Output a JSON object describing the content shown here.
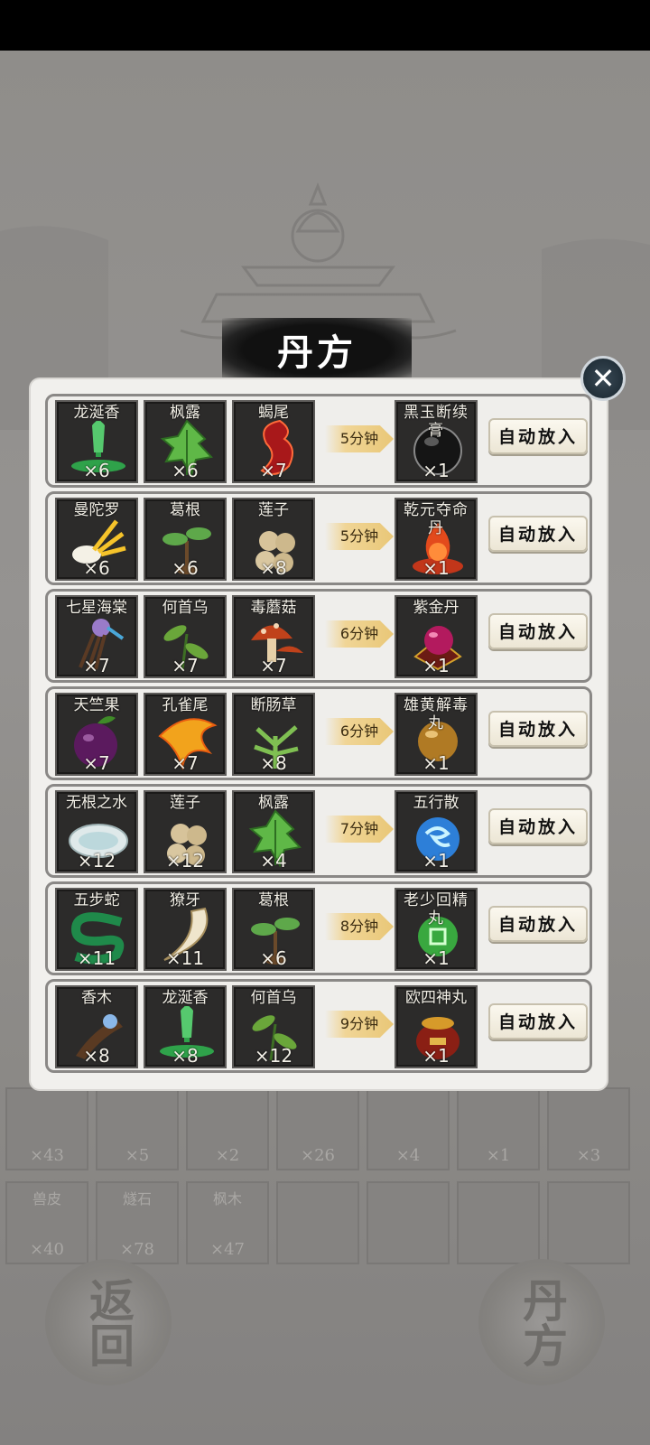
{
  "title": "丹方",
  "recipes": [
    {
      "ingredients": [
        {
          "name": "龙涎香",
          "count": "×6",
          "icon": "green-ooze-icon"
        },
        {
          "name": "枫露",
          "count": "×6",
          "icon": "green-leaf-icon"
        },
        {
          "name": "蝎尾",
          "count": "×7",
          "icon": "red-scorpion-tail-icon"
        }
      ],
      "time": "5分钟",
      "product": {
        "name": "黑玉断续膏",
        "count": "×1",
        "icon": "black-orb-icon"
      },
      "action": "自动放入"
    },
    {
      "ingredients": [
        {
          "name": "曼陀罗",
          "count": "×6",
          "icon": "white-flower-icon"
        },
        {
          "name": "葛根",
          "count": "×6",
          "icon": "sprout-icon"
        },
        {
          "name": "莲子",
          "count": "×8",
          "icon": "lotus-seed-icon"
        }
      ],
      "time": "5分钟",
      "product": {
        "name": "乾元夺命丹",
        "count": "×1",
        "icon": "red-flame-pill-icon"
      },
      "action": "自动放入"
    },
    {
      "ingredients": [
        {
          "name": "七星海棠",
          "count": "×7",
          "icon": "purple-flower-icon"
        },
        {
          "name": "何首乌",
          "count": "×7",
          "icon": "green-herb-icon"
        },
        {
          "name": "毒蘑菇",
          "count": "×7",
          "icon": "red-mushroom-icon"
        }
      ],
      "time": "6分钟",
      "product": {
        "name": "紫金丹",
        "count": "×1",
        "icon": "purple-gold-pill-icon"
      },
      "action": "自动放入"
    },
    {
      "ingredients": [
        {
          "name": "天竺果",
          "count": "×7",
          "icon": "purple-fruit-icon"
        },
        {
          "name": "孔雀尾",
          "count": "×7",
          "icon": "orange-feather-icon"
        },
        {
          "name": "断肠草",
          "count": "×8",
          "icon": "green-grass-icon"
        }
      ],
      "time": "6分钟",
      "product": {
        "name": "雄黄解毒丸",
        "count": "×1",
        "icon": "golden-pill-icon"
      },
      "action": "自动放入"
    },
    {
      "ingredients": [
        {
          "name": "无根之水",
          "count": "×12",
          "icon": "water-dish-icon"
        },
        {
          "name": "莲子",
          "count": "×12",
          "icon": "lotus-seed-icon"
        },
        {
          "name": "枫露",
          "count": "×4",
          "icon": "green-leaf-icon"
        }
      ],
      "time": "7分钟",
      "product": {
        "name": "五行散",
        "count": "×1",
        "icon": "blue-swirl-icon"
      },
      "action": "自动放入"
    },
    {
      "ingredients": [
        {
          "name": "五步蛇",
          "count": "×11",
          "icon": "green-snake-icon"
        },
        {
          "name": "獠牙",
          "count": "×11",
          "icon": "fang-icon"
        },
        {
          "name": "葛根",
          "count": "×6",
          "icon": "sprout-icon"
        }
      ],
      "time": "8分钟",
      "product": {
        "name": "老少回精丸",
        "count": "×1",
        "icon": "green-rune-pill-icon"
      },
      "action": "自动放入"
    },
    {
      "ingredients": [
        {
          "name": "香木",
          "count": "×8",
          "icon": "incense-wood-icon"
        },
        {
          "name": "龙涎香",
          "count": "×8",
          "icon": "green-ooze-icon"
        },
        {
          "name": "何首乌",
          "count": "×12",
          "icon": "green-herb-icon"
        }
      ],
      "time": "9分钟",
      "product": {
        "name": "欧四神丸",
        "count": "×1",
        "icon": "red-jar-icon"
      },
      "action": "自动放入"
    }
  ],
  "background_inventory": {
    "row1_counts": [
      "×43",
      "×5",
      "×2",
      "×26",
      "×4",
      "×1",
      "×3"
    ],
    "row2": [
      {
        "name": "兽皮",
        "count": "×40"
      },
      {
        "name": "燧石",
        "count": "×78"
      },
      {
        "name": "枫木",
        "count": "×47"
      }
    ]
  },
  "background_buttons": {
    "back": "返回",
    "recipe": "丹方"
  },
  "close_label": "✕"
}
